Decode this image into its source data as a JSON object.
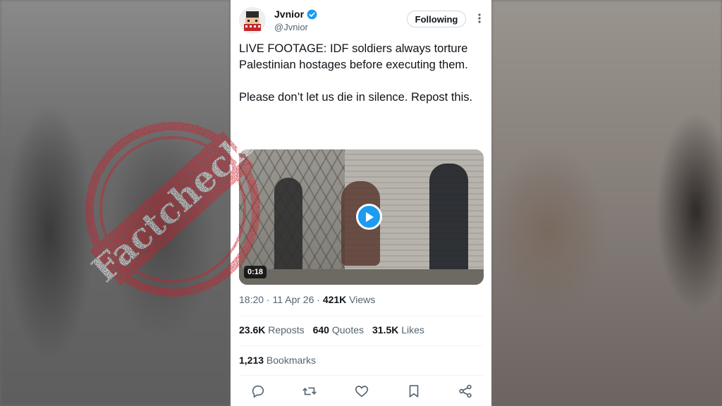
{
  "profile": {
    "name": "Jvnior",
    "handle": "@Jvnior",
    "verified_icon": "verified-badge-icon"
  },
  "follow_button": {
    "label": "Following"
  },
  "tweet": {
    "paragraphs": [
      "LIVE FOOTAGE: IDF soldiers always torture Palestinian hostages before executing them.",
      "Please don’t let us die in silence. Repost this."
    ]
  },
  "video": {
    "duration": "0:18"
  },
  "meta": {
    "time_date": "18:20 · 11 Apr 26 · ",
    "views_count": "421K",
    "views_label": " Views"
  },
  "stats": {
    "reposts_count": "23.6K",
    "reposts_label": " Reposts",
    "quotes_count": "640",
    "quotes_label": " Quotes",
    "likes_count": "31.5K",
    "likes_label": " Likes",
    "bookmarks_count": "1,213",
    "bookmarks_label": " Bookmarks"
  },
  "stamp": {
    "text": "Factcheck"
  },
  "colors": {
    "accent": "#1d9bf0",
    "stamp_red": "#c8202c",
    "text_primary": "#0f1419",
    "text_secondary": "#536471"
  }
}
